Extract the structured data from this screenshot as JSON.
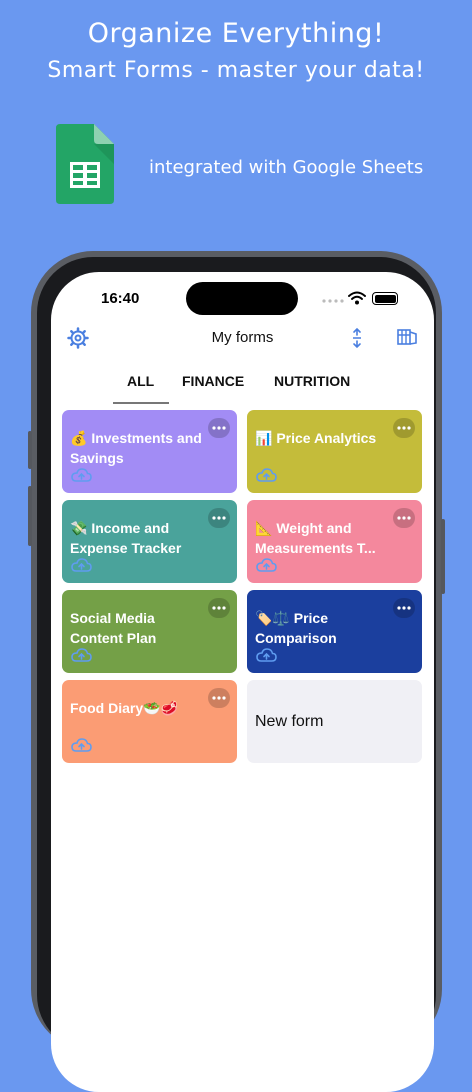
{
  "promo": {
    "headline": "Organize Everything!",
    "subheadline": "Smart Forms - master your data!",
    "integration": "integrated with Google Sheets"
  },
  "status_bar": {
    "time": "16:40"
  },
  "nav": {
    "title": "My forms"
  },
  "tabs": [
    {
      "label": "ALL",
      "active": true
    },
    {
      "label": "FINANCE",
      "active": false
    },
    {
      "label": "NUTRITION",
      "active": false
    }
  ],
  "forms": [
    {
      "title": "💰 Investments and Savings",
      "color": "#a28cf5"
    },
    {
      "title": "📊 Price Analytics",
      "color": "#c4bc3a"
    },
    {
      "title": "💸 Income and Expense Tracker",
      "color": "#4aa39b"
    },
    {
      "title": "📐 Weight and Measurements T...",
      "color": "#f4889d"
    },
    {
      "title": "Social Media Content Plan",
      "color": "#74a047"
    },
    {
      "title": "🏷️⚖️ Price Comparison",
      "color": "#1b3f9e"
    },
    {
      "title": "Food Diary🥗🥩",
      "color": "#fb9c74"
    }
  ],
  "new_form": {
    "label": "New form"
  }
}
